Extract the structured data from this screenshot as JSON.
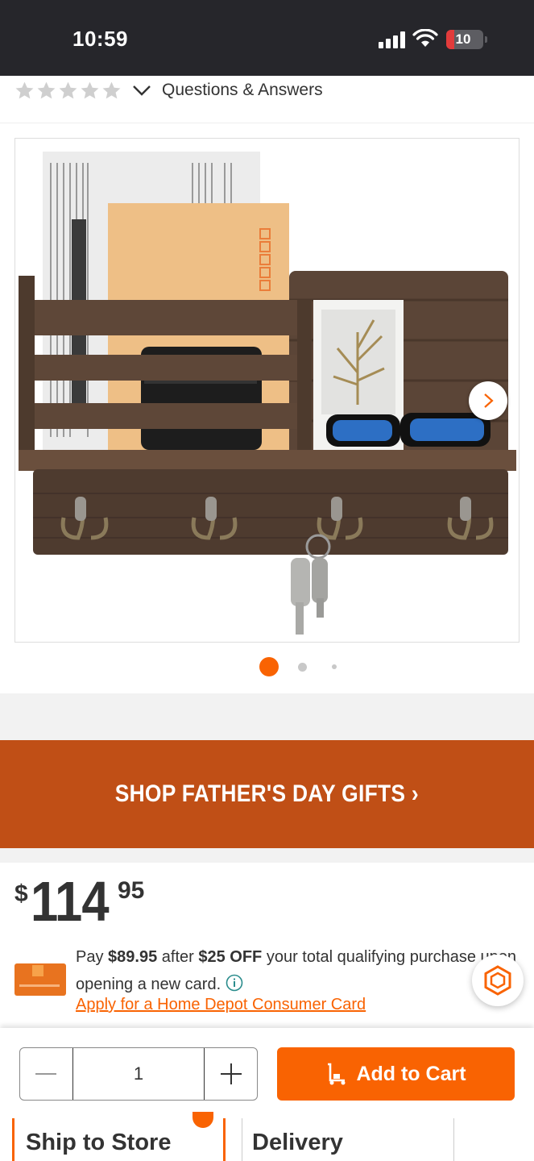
{
  "status_bar": {
    "time": "10:59",
    "battery": "10"
  },
  "rating": {
    "qa_label": "Questions & Answers"
  },
  "gallery": {
    "image_count": 3,
    "active_index": 0
  },
  "promo": {
    "label": "SHOP FATHER'S DAY GIFTS ›"
  },
  "price": {
    "currency": "$",
    "dollars": "114",
    "cents": "95"
  },
  "card_offer": {
    "pay": "Pay",
    "sale_price": "$89.95",
    "after": "after",
    "discount": "$25 OFF",
    "rest": "your total qualifying purchase upon opening a new card.",
    "apply_link": "Apply for a Home Depot Consumer Card"
  },
  "cart": {
    "quantity": "1",
    "add_label": "Add to Cart"
  },
  "fulfillment": {
    "ship_label": "Ship to Store",
    "delivery_label": "Delivery"
  },
  "colors": {
    "brand_orange": "#f96302",
    "promo_bg": "#c04f16",
    "status_bar_bg": "#26262b"
  }
}
